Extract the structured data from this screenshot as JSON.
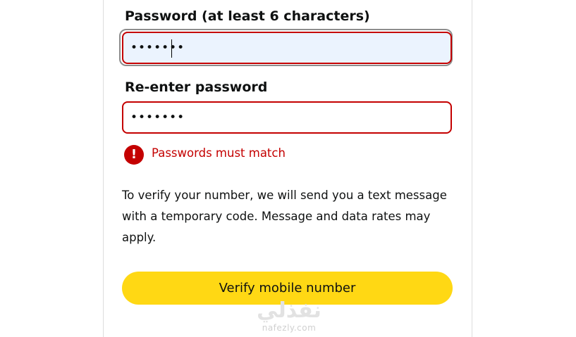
{
  "form": {
    "password_label": "Password (at least 6 characters)",
    "password_value": "•••••••",
    "reenter_label": "Re-enter password",
    "reenter_value": "•••••••",
    "error_icon": "!",
    "error_message": "Passwords must match",
    "info_text": "To verify your number, we will send you a text message with a temporary code. Message and data rates may apply.",
    "verify_button": "Verify mobile number"
  },
  "watermark": {
    "arabic": "نفذلي",
    "latin": "nafezly.com"
  },
  "colors": {
    "error": "#c40000",
    "button": "#ffd814",
    "focused_input_bg": "#ebf3fe"
  }
}
